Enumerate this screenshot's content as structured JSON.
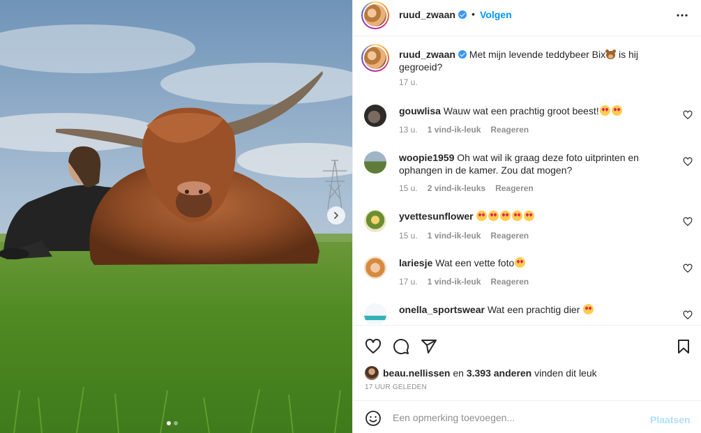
{
  "post": {
    "username": "ruud_zwaan",
    "follow_label": "Volgen",
    "separator": "•",
    "caption_text": "Met mijn levende teddybeer Bix",
    "caption_emoji": "teddy-bear-emoji",
    "caption_text_2": " is hij gegroeid?",
    "caption_time": "17 u.",
    "carousel_slides": 2,
    "carousel_active_index": 0
  },
  "comments": [
    {
      "username": "gouwlisa",
      "text": "Wauw wat een prachtig groot beest!",
      "emoji_count": 2,
      "time": "13 u.",
      "likes": "1 vind-ik-leuk",
      "reply": "Reageren"
    },
    {
      "username": "woopie1959",
      "text": "Oh wat wil ik graag deze foto uitprinten en ophangen in de kamer. Zou dat mogen?",
      "emoji_count": 0,
      "time": "15 u.",
      "likes": "2 vind-ik-leuks",
      "reply": "Reageren"
    },
    {
      "username": "yvettesunflower",
      "text": "",
      "emoji_count": 5,
      "time": "15 u.",
      "likes": "1 vind-ik-leuk",
      "reply": "Reageren"
    },
    {
      "username": "lariesje",
      "text": "Wat een vette foto",
      "emoji_count": 1,
      "time": "17 u.",
      "likes": "1 vind-ik-leuk",
      "reply": "Reageren"
    },
    {
      "username": "onella_sportswear",
      "text": "Wat een prachtig dier ",
      "emoji_count": 1
    }
  ],
  "likes": {
    "first_user": "beau.nellissen",
    "connector": " en ",
    "count": "3.393 anderen",
    "suffix": " vinden dit leuk",
    "ago": "17 UUR GELEDEN"
  },
  "add_comment": {
    "placeholder": "Een opmerking toevoegen...",
    "post_label": "Plaatsen"
  },
  "colors": {
    "accent": "#0095f6",
    "post_disabled": "#b2dffc",
    "muted": "#8e8e8e",
    "text": "#262626",
    "verified": "#3897f0"
  },
  "icons": [
    "heart-icon",
    "comment-icon",
    "share-icon",
    "bookmark-icon",
    "emoji-icon",
    "more-icon",
    "chevron-right-icon",
    "verified-icon"
  ]
}
